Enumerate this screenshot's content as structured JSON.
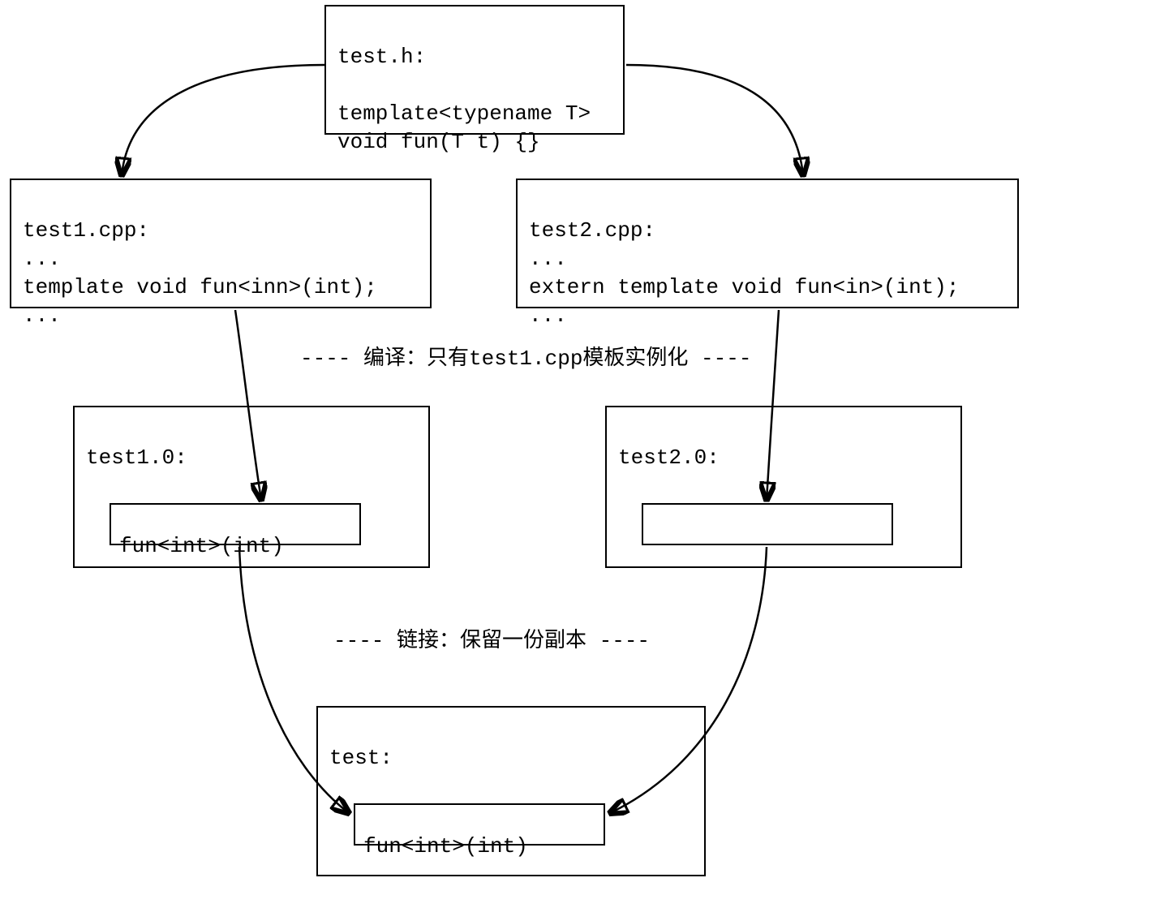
{
  "header": {
    "title": "test.h:",
    "line1": "template<typename T>",
    "line2": "void fun(T t) {}"
  },
  "left_cpp": {
    "title": "test1.cpp:",
    "dots1": "...",
    "line": "template void fun<inn>(int);",
    "dots2": "..."
  },
  "right_cpp": {
    "title": "test2.cpp:",
    "dots1": "...",
    "line": "extern template void fun<in>(int);",
    "dots2": "..."
  },
  "compile_label": "----  编译：只有test1.cpp模板实例化 ----",
  "left_obj": {
    "title": "test1.0:",
    "inner": "fun<int>(int)"
  },
  "right_obj": {
    "title": "test2.0:",
    "inner": ""
  },
  "link_label": "----  链接：保留一份副本 ----",
  "final": {
    "title": "test:",
    "inner": "fun<int>(int)"
  }
}
